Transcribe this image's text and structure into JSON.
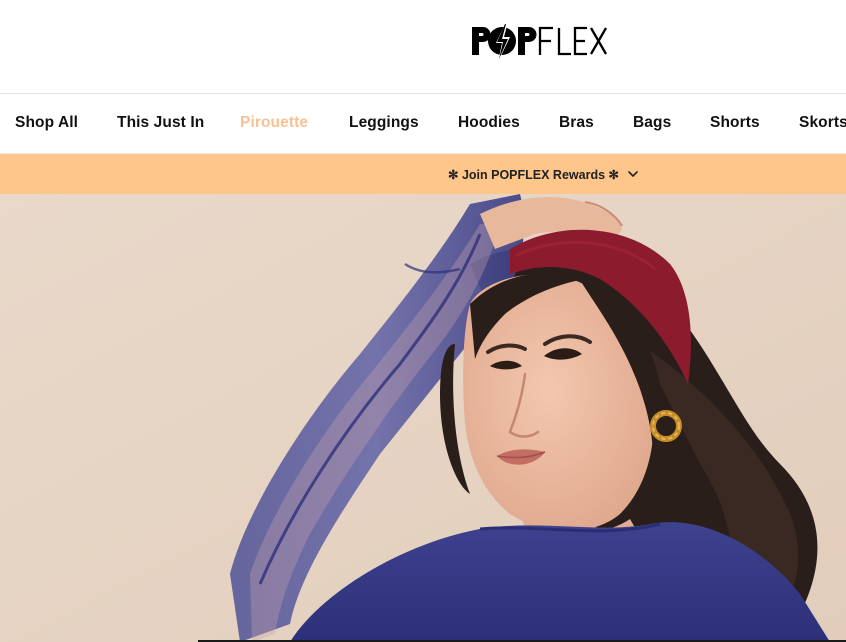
{
  "brand": {
    "logo_text": "POPFLEX"
  },
  "nav": {
    "items": [
      {
        "label": "Shop All"
      },
      {
        "label": "This Just In"
      },
      {
        "label": "Pirouette"
      },
      {
        "label": "Leggings"
      },
      {
        "label": "Hoodies"
      },
      {
        "label": "Bras"
      },
      {
        "label": "Bags"
      },
      {
        "label": "Shorts"
      },
      {
        "label": "Skorts"
      }
    ],
    "active_index": 2
  },
  "promo": {
    "label": "✻ Join POPFLEX Rewards ✻",
    "icon": "chevron-down-icon"
  },
  "hero": {
    "image_subject": "model-portrait"
  },
  "colors": {
    "promo_bg": "#ffc68b",
    "active_nav": "#f7c193",
    "hero_bg": "#e6d4c4",
    "text": "#111111"
  }
}
